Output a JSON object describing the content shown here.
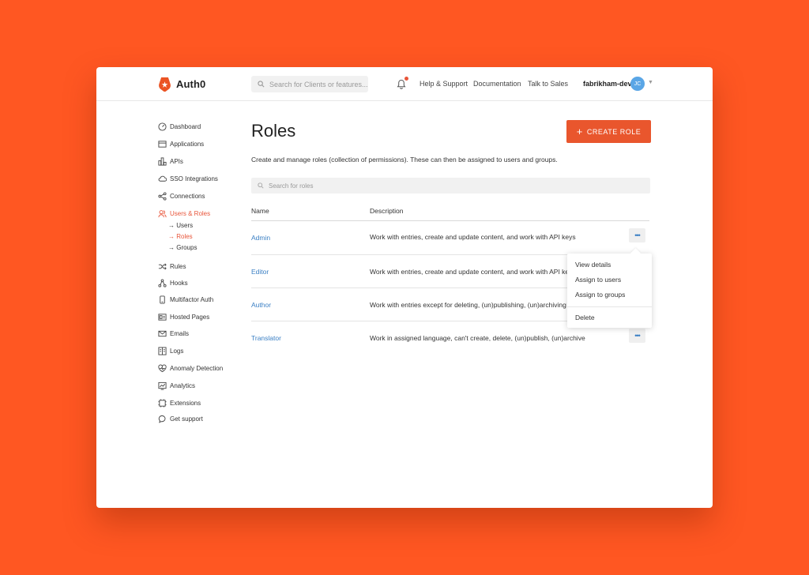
{
  "brand": {
    "name": "Auth0",
    "color": "#EB5424"
  },
  "topbar": {
    "search_placeholder": "Search for Clients or features...",
    "links": [
      "Help & Support",
      "Documentation",
      "Talk to Sales"
    ],
    "tenant": "fabrikham-dev",
    "avatar_initials": "JC"
  },
  "sidebar": {
    "items": [
      {
        "label": "Dashboard",
        "icon": "dashboard-icon"
      },
      {
        "label": "Applications",
        "icon": "applications-icon"
      },
      {
        "label": "APIs",
        "icon": "apis-icon"
      },
      {
        "label": "SSO Integrations",
        "icon": "sso-icon"
      },
      {
        "label": "Connections",
        "icon": "connections-icon"
      },
      {
        "label": "Users & Roles",
        "icon": "users-icon",
        "active": true
      },
      {
        "label": "Rules",
        "icon": "rules-icon"
      },
      {
        "label": "Hooks",
        "icon": "hooks-icon"
      },
      {
        "label": "Multifactor Auth",
        "icon": "mfa-icon"
      },
      {
        "label": "Hosted Pages",
        "icon": "hosted-pages-icon"
      },
      {
        "label": "Emails",
        "icon": "emails-icon"
      },
      {
        "label": "Logs",
        "icon": "logs-icon"
      },
      {
        "label": "Anomaly Detection",
        "icon": "anomaly-icon"
      },
      {
        "label": "Analytics",
        "icon": "analytics-icon"
      },
      {
        "label": "Extensions",
        "icon": "extensions-icon"
      },
      {
        "label": "Get support",
        "icon": "support-icon"
      }
    ],
    "subitems": [
      {
        "label": "→ Users"
      },
      {
        "label": "→ Roles",
        "active": true
      },
      {
        "label": "→ Groups"
      }
    ]
  },
  "main": {
    "title": "Roles",
    "create_button": "CREATE ROLE",
    "description": "Create and manage roles (collection of permissions). These can then be assigned to users and groups.",
    "search_placeholder": "Search for roles",
    "columns": [
      "Name",
      "Description"
    ],
    "rows": [
      {
        "name": "Admin",
        "description": "Work with entries, create and update content, and work with API keys"
      },
      {
        "name": "Editor",
        "description": "Work with entries, create and update content, and work with API keys"
      },
      {
        "name": "Author",
        "description": "Work with entries except for deleting, (un)publishing, (un)archiving e"
      },
      {
        "name": "Translator",
        "description": "Work in assigned language, can't create, delete, (un)publish, (un)archive"
      }
    ],
    "more_label": "•••"
  },
  "dropdown": {
    "items": [
      "View details",
      "Assign to users",
      "Assign to groups"
    ],
    "danger_item": "Delete"
  },
  "colors": {
    "background": "#FF5722",
    "accent": "#E9562D",
    "link": "#3A7FC4"
  }
}
